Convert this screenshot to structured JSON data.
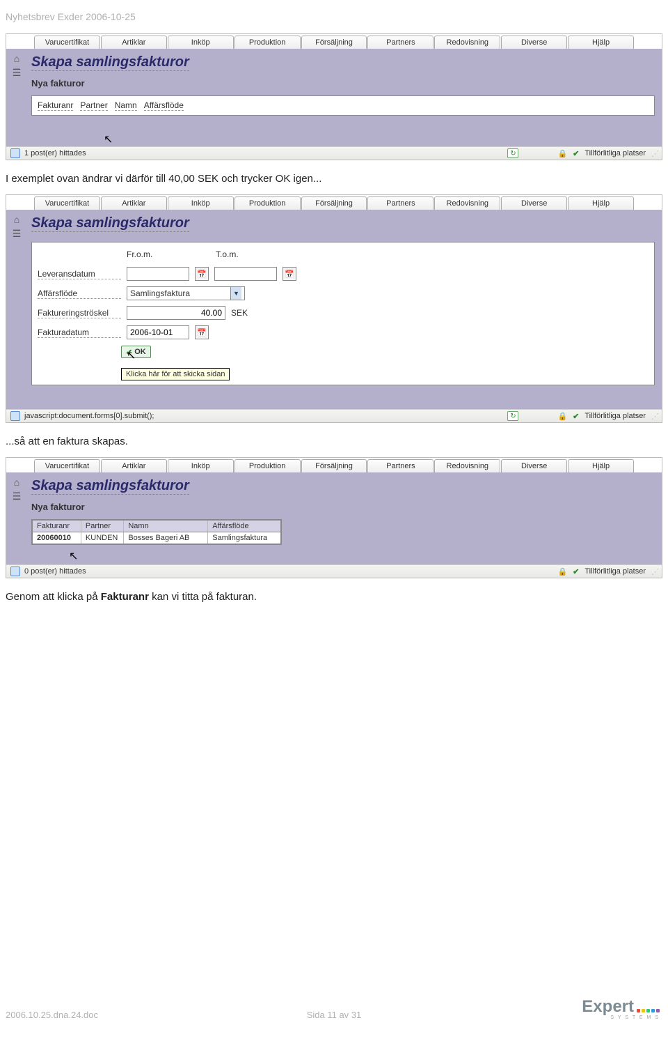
{
  "doc": {
    "header": "Nyhetsbrev Exder 2006-10-25",
    "caption1": "I exemplet ovan ändrar vi därför till 40,00 SEK och trycker OK igen...",
    "caption2": "...så att en faktura skapas.",
    "caption3_pre": "Genom att klicka på ",
    "caption3_bold": "Fakturanr",
    "caption3_post": " kan vi titta på fakturan.",
    "footer_left": "2006.10.25.dna.24.doc",
    "footer_center": "Sida 11 av 31",
    "logo_text": "Expert",
    "logo_sub": "S Y S T E M S"
  },
  "tabs": [
    "Varucertifikat",
    "Artiklar",
    "Inköp",
    "Produktion",
    "Försäljning",
    "Partners",
    "Redovisning",
    "Diverse",
    "Hjälp"
  ],
  "app": {
    "title": "Skapa samlingsfakturor",
    "sub": "Nya fakturor",
    "cols": [
      "Fakturanr",
      "Partner",
      "Namn",
      "Affärsflöde"
    ]
  },
  "s1": {
    "status_left": "1 post(er) hittades",
    "status_right": "Tillförlitliga platser"
  },
  "s2": {
    "form": {
      "col_from": "Fr.o.m.",
      "col_to": "T.o.m.",
      "leveransdatum_label": "Leveransdatum",
      "leveransdatum_from": "",
      "leveransdatum_to": "",
      "affarsflode_label": "Affärsflöde",
      "affarsflode_value": "Samlingsfaktura",
      "faktureringstroskel_label": "Faktureringströskel",
      "faktureringstroskel_value": "40.00",
      "faktureringstroskel_unit": "SEK",
      "fakturadatum_label": "Fakturadatum",
      "fakturadatum_value": "2006-10-01",
      "ok_label": "OK",
      "tooltip": "Klicka här för att skicka sidan"
    },
    "status_left": "javascript:document.forms[0].submit();",
    "status_right": "Tillförlitliga platser"
  },
  "s3": {
    "row": {
      "fakturanr": "20060010",
      "partner": "KUNDEN",
      "namn": "Bosses Bageri AB",
      "affarsflode": "Samlingsfaktura"
    },
    "status_left": "0 post(er) hittades",
    "status_right": "Tillförlitliga platser"
  }
}
